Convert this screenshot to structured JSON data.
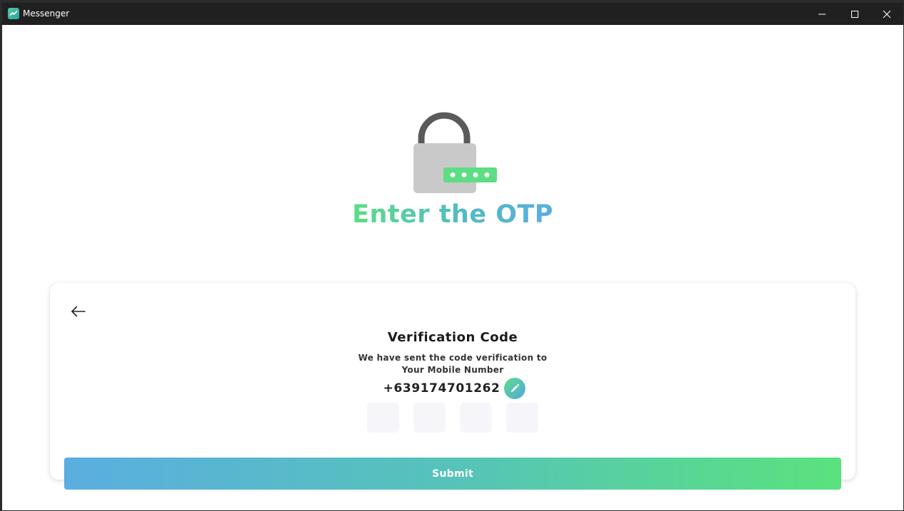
{
  "window": {
    "title": "Messenger",
    "icon": "messenger-app-icon",
    "controls": {
      "minimize_icon": "minimize-icon",
      "maximize_icon": "maximize-icon",
      "close_icon": "close-icon"
    }
  },
  "hero": {
    "illustration": "lock-with-password-dots",
    "title": "Enter the OTP",
    "title_gradient": [
      "#5ddd84",
      "#5aaedf"
    ]
  },
  "card": {
    "back_icon": "arrow-left-icon",
    "title": "Verification Code",
    "subtitle_line1": "We have sent the code verification to",
    "subtitle_line2": "Your Mobile Number",
    "phone_number": "+639174701262",
    "edit_icon": "pencil-icon",
    "otp_digits": [
      "",
      "",
      "",
      ""
    ],
    "submit_label": "Submit"
  },
  "colors": {
    "accent_green": "#5ddd84",
    "accent_blue": "#5aaedf",
    "lock_body": "#c9c9c9",
    "lock_shackle": "#5a5a5a"
  }
}
